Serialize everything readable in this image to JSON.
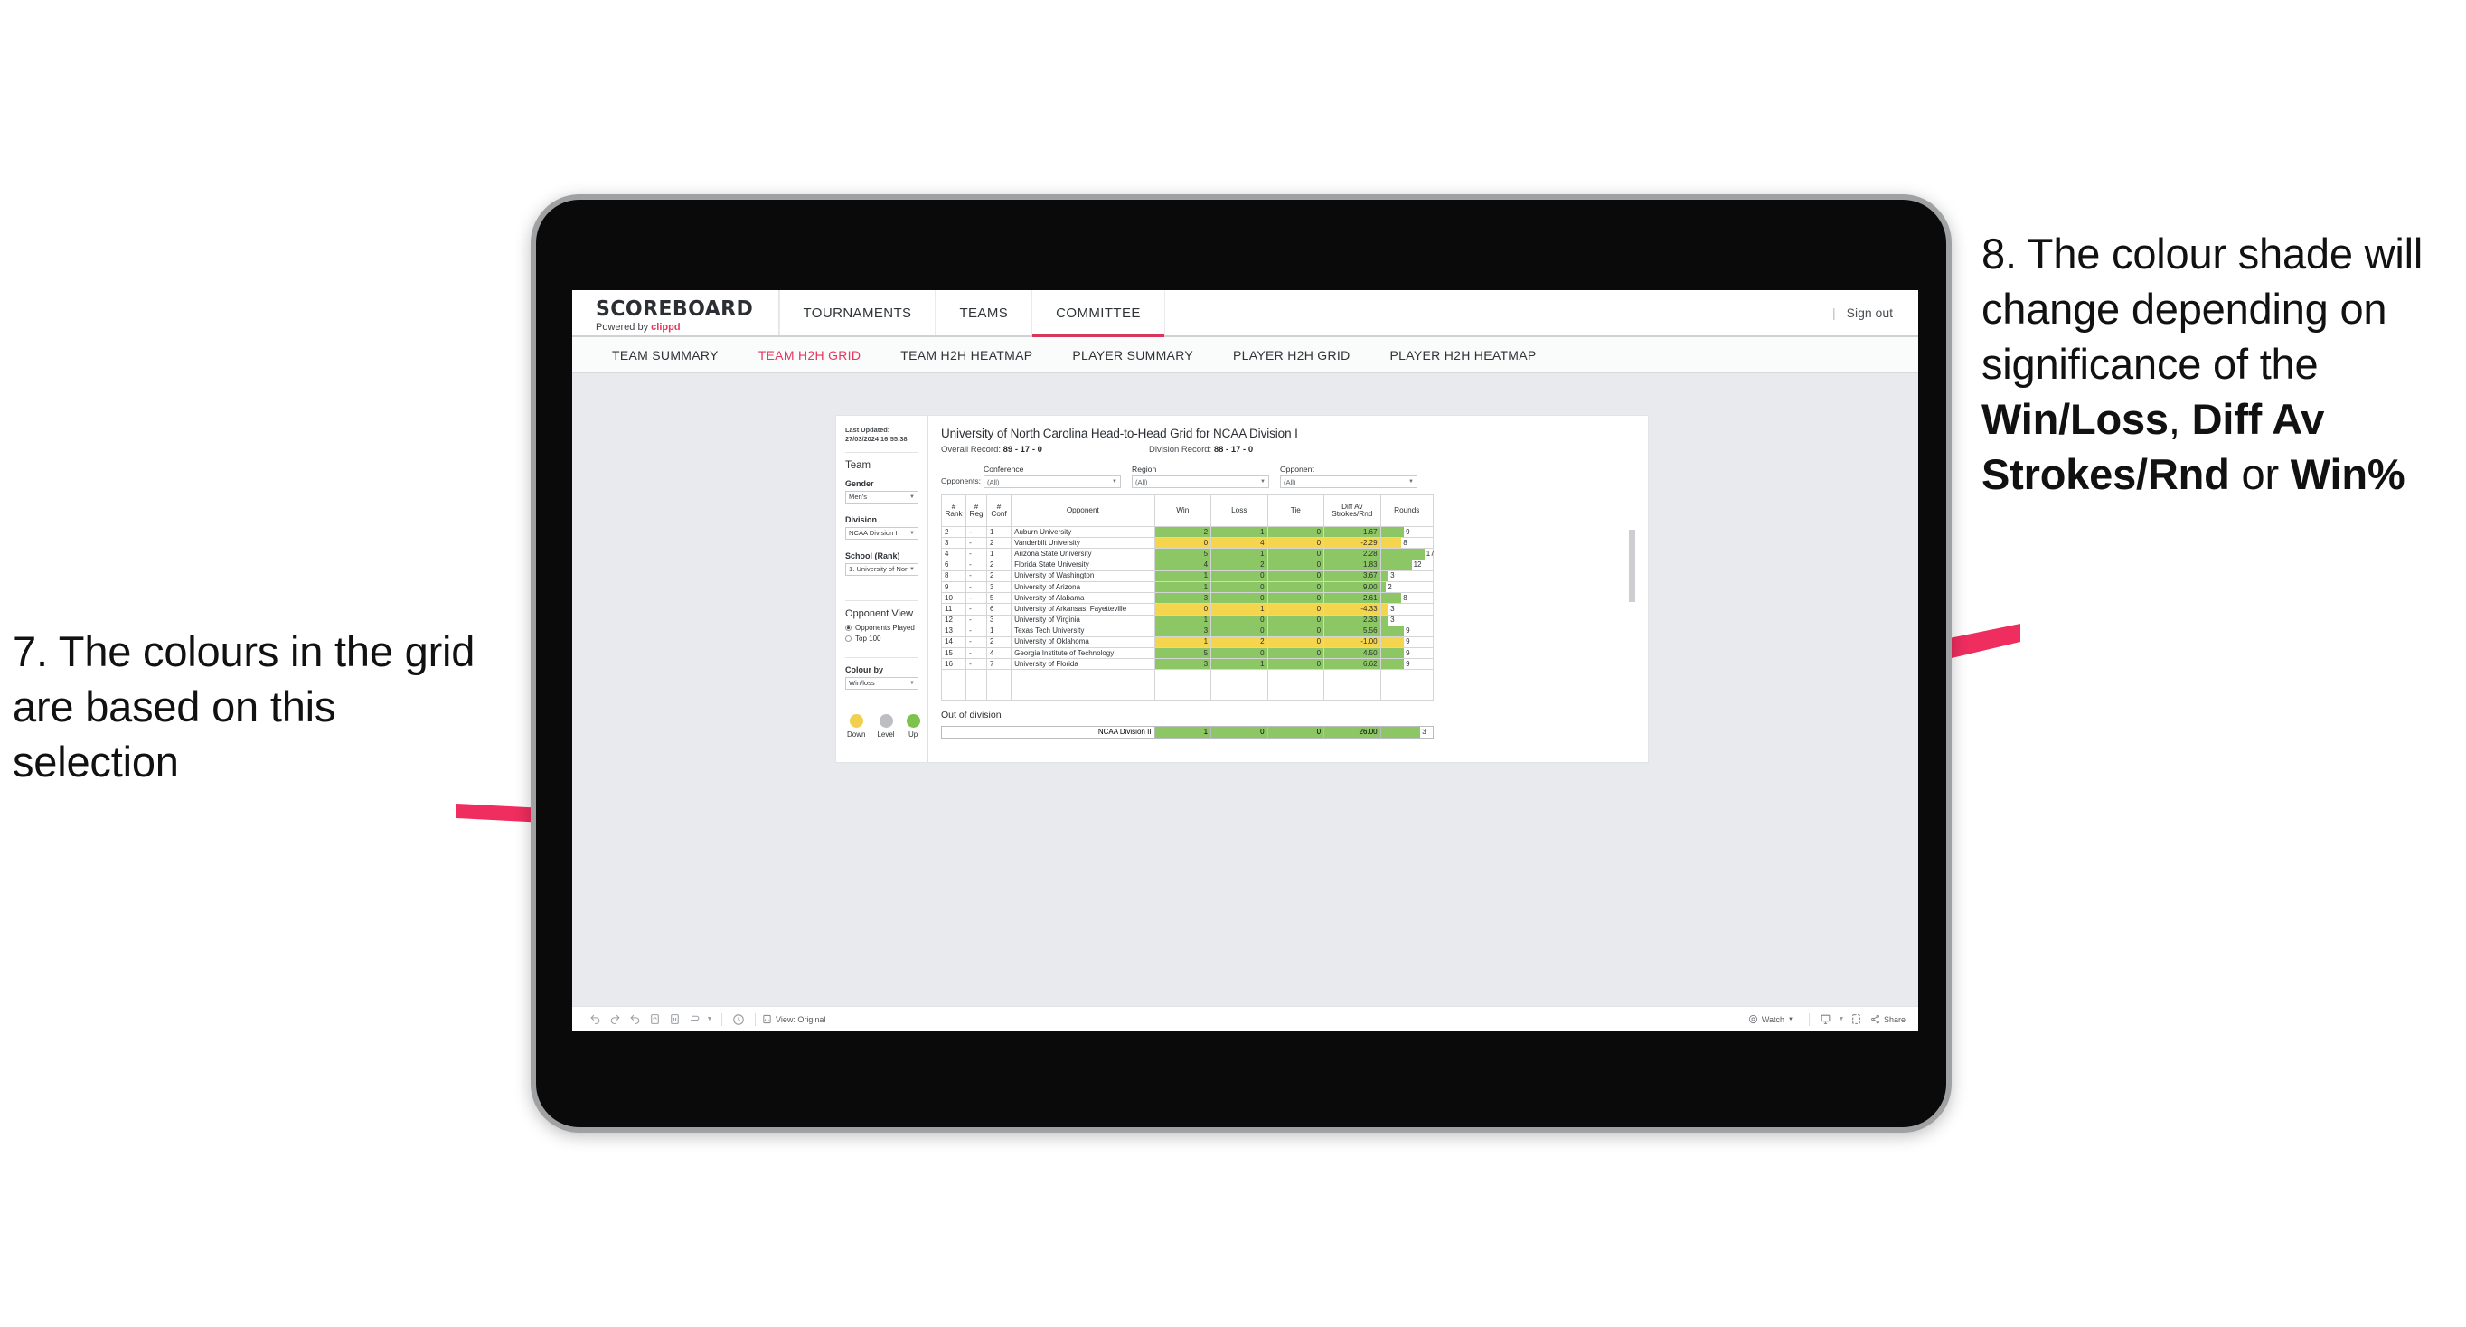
{
  "annotations": {
    "left": {
      "number": "7.",
      "text": "7. The colours in the grid are based on this selection"
    },
    "right": {
      "part1": "8. The colour shade will change depending on significance of the ",
      "bold1": "Win/Loss",
      "mid1": ", ",
      "bold2": "Diff Av Strokes/Rnd",
      "mid2": " or ",
      "bold3": "Win%"
    },
    "arrow_color": "#ef2d5e"
  },
  "app": {
    "brand": {
      "title": "SCOREBOARD",
      "powered_by": "Powered by",
      "vendor": "clippd"
    },
    "topnav": [
      {
        "label": "TOURNAMENTS",
        "active": false
      },
      {
        "label": "TEAMS",
        "active": false
      },
      {
        "label": "COMMITTEE",
        "active": true
      }
    ],
    "signout": {
      "divider": "|",
      "label": "Sign out"
    },
    "subnav": [
      {
        "label": "TEAM SUMMARY",
        "active": false
      },
      {
        "label": "TEAM H2H GRID",
        "active": true
      },
      {
        "label": "TEAM H2H HEATMAP",
        "active": false
      },
      {
        "label": "PLAYER SUMMARY",
        "active": false
      },
      {
        "label": "PLAYER H2H GRID",
        "active": false
      },
      {
        "label": "PLAYER H2H HEATMAP",
        "active": false
      }
    ]
  },
  "sidebar": {
    "last_updated": "Last Updated: 27/03/2024 16:55:38",
    "team_heading": "Team",
    "fields": [
      {
        "label": "Gender",
        "value": "Men's"
      },
      {
        "label": "Division",
        "value": "NCAA Division I"
      },
      {
        "label": "School (Rank)",
        "value": "1. University of Nort..."
      }
    ],
    "opponent_view": {
      "heading": "Opponent View",
      "options": [
        {
          "label": "Opponents Played",
          "selected": true
        },
        {
          "label": "Top 100",
          "selected": false
        }
      ]
    },
    "colour_by": {
      "label": "Colour by",
      "value": "Win/loss"
    },
    "legend": [
      {
        "label": "Down",
        "color": "#f0d04e"
      },
      {
        "label": "Level",
        "color": "#bcbec1"
      },
      {
        "label": "Up",
        "color": "#7dc24b"
      }
    ]
  },
  "viz": {
    "title": "University of North Carolina Head-to-Head Grid for NCAA Division I",
    "overall_record_label": "Overall Record: ",
    "overall_record_value": "89 - 17 - 0",
    "division_record_label": "Division Record: ",
    "division_record_value": "88 - 17 - 0",
    "opponents_label": "Opponents:",
    "filters": [
      {
        "label": "Conference",
        "value": "(All)"
      },
      {
        "label": "Region",
        "value": "(All)"
      },
      {
        "label": "Opponent",
        "value": "(All)"
      }
    ],
    "columns": [
      "# Rank",
      "# Reg",
      "# Conf",
      "Opponent",
      "Win",
      "Loss",
      "Tie",
      "Diff Av Strokes/Rnd",
      "Rounds"
    ],
    "column_head_lines": {
      "rank": [
        "#",
        "Rank"
      ],
      "reg": [
        "#",
        "Reg"
      ],
      "conf": [
        "#",
        "Conf"
      ],
      "opponent": [
        "Opponent"
      ],
      "win": [
        "Win"
      ],
      "loss": [
        "Loss"
      ],
      "tie": [
        "Tie"
      ],
      "diff": [
        "Diff Av",
        "Strokes/Rnd"
      ],
      "rounds": [
        "Rounds"
      ]
    },
    "rows": [
      {
        "rank": "2",
        "reg": "-",
        "conf": "1",
        "opponent": "Auburn University",
        "win": "2",
        "loss": "1",
        "tie": "0",
        "diff": "1.67",
        "rounds": "9",
        "result": "win"
      },
      {
        "rank": "3",
        "reg": "-",
        "conf": "2",
        "opponent": "Vanderbilt University",
        "win": "0",
        "loss": "4",
        "tie": "0",
        "diff": "-2.29",
        "rounds": "8",
        "result": "loss"
      },
      {
        "rank": "4",
        "reg": "-",
        "conf": "1",
        "opponent": "Arizona State University",
        "win": "5",
        "loss": "1",
        "tie": "0",
        "diff": "2.28",
        "rounds": "17",
        "result": "win"
      },
      {
        "rank": "6",
        "reg": "-",
        "conf": "2",
        "opponent": "Florida State University",
        "win": "4",
        "loss": "2",
        "tie": "0",
        "diff": "1.83",
        "rounds": "12",
        "result": "win"
      },
      {
        "rank": "8",
        "reg": "-",
        "conf": "2",
        "opponent": "University of Washington",
        "win": "1",
        "loss": "0",
        "tie": "0",
        "diff": "3.67",
        "rounds": "3",
        "result": "win"
      },
      {
        "rank": "9",
        "reg": "-",
        "conf": "3",
        "opponent": "University of Arizona",
        "win": "1",
        "loss": "0",
        "tie": "0",
        "diff": "9.00",
        "rounds": "2",
        "result": "win"
      },
      {
        "rank": "10",
        "reg": "-",
        "conf": "5",
        "opponent": "University of Alabama",
        "win": "3",
        "loss": "0",
        "tie": "0",
        "diff": "2.61",
        "rounds": "8",
        "result": "win"
      },
      {
        "rank": "11",
        "reg": "-",
        "conf": "6",
        "opponent": "University of Arkansas, Fayetteville",
        "win": "0",
        "loss": "1",
        "tie": "0",
        "diff": "-4.33",
        "rounds": "3",
        "result": "loss"
      },
      {
        "rank": "12",
        "reg": "-",
        "conf": "3",
        "opponent": "University of Virginia",
        "win": "1",
        "loss": "0",
        "tie": "0",
        "diff": "2.33",
        "rounds": "3",
        "result": "win"
      },
      {
        "rank": "13",
        "reg": "-",
        "conf": "1",
        "opponent": "Texas Tech University",
        "win": "3",
        "loss": "0",
        "tie": "0",
        "diff": "5.56",
        "rounds": "9",
        "result": "win"
      },
      {
        "rank": "14",
        "reg": "-",
        "conf": "2",
        "opponent": "University of Oklahoma",
        "win": "1",
        "loss": "2",
        "tie": "0",
        "diff": "-1.00",
        "rounds": "9",
        "result": "loss"
      },
      {
        "rank": "15",
        "reg": "-",
        "conf": "4",
        "opponent": "Georgia Institute of Technology",
        "win": "5",
        "loss": "0",
        "tie": "0",
        "diff": "4.50",
        "rounds": "9",
        "result": "win"
      },
      {
        "rank": "16",
        "reg": "-",
        "conf": "7",
        "opponent": "University of Florida",
        "win": "3",
        "loss": "1",
        "tie": "0",
        "diff": "6.62",
        "rounds": "9",
        "result": "win"
      }
    ],
    "out_of_division": {
      "title": "Out of division",
      "row": {
        "name": "NCAA Division II",
        "win": "1",
        "loss": "0",
        "tie": "0",
        "diff": "26.00",
        "rounds": "3",
        "result": "win"
      }
    }
  },
  "toolbar": {
    "view_label": "View: Original",
    "watch_label": "Watch",
    "share_label": "Share",
    "icons": [
      "undo-icon",
      "redo-icon",
      "revert-icon",
      "refresh-icon",
      "pause-icon",
      "alerts-icon",
      "clock-icon",
      "view-icon"
    ]
  },
  "colors": {
    "accent_pink": "#e8365d",
    "win_green": "#8cc665",
    "loss_yellow": "#f5d44e",
    "arrow": "#ef2d5e"
  }
}
